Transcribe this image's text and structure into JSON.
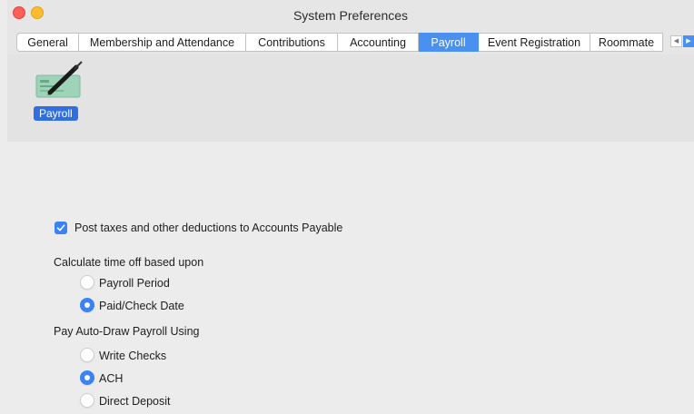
{
  "window": {
    "title": "System Preferences"
  },
  "tabs": [
    {
      "label": "General",
      "active": false
    },
    {
      "label": "Membership and Attendance",
      "active": false
    },
    {
      "label": "Contributions",
      "active": false
    },
    {
      "label": "Accounting",
      "active": false
    },
    {
      "label": "Payroll",
      "active": true
    },
    {
      "label": "Event Registration",
      "active": false
    },
    {
      "label": "Roommate",
      "active": false
    }
  ],
  "icon_pane": {
    "selected_label": "Payroll",
    "icon": "check-and-pen-icon"
  },
  "options": {
    "post_taxes": {
      "label": "Post taxes and other deductions to Accounts Payable",
      "checked": true
    },
    "time_off": {
      "heading": "Calculate time off based upon",
      "choices": [
        "Payroll Period",
        "Paid/Check Date"
      ],
      "selected": "Paid/Check Date"
    },
    "auto_draw": {
      "heading": "Pay Auto-Draw Payroll Using",
      "choices": [
        "Write Checks",
        "ACH",
        "Direct Deposit"
      ],
      "selected": "ACH"
    }
  },
  "colors": {
    "accent": "#3b82f6",
    "tab_active": "#4a90f0"
  }
}
